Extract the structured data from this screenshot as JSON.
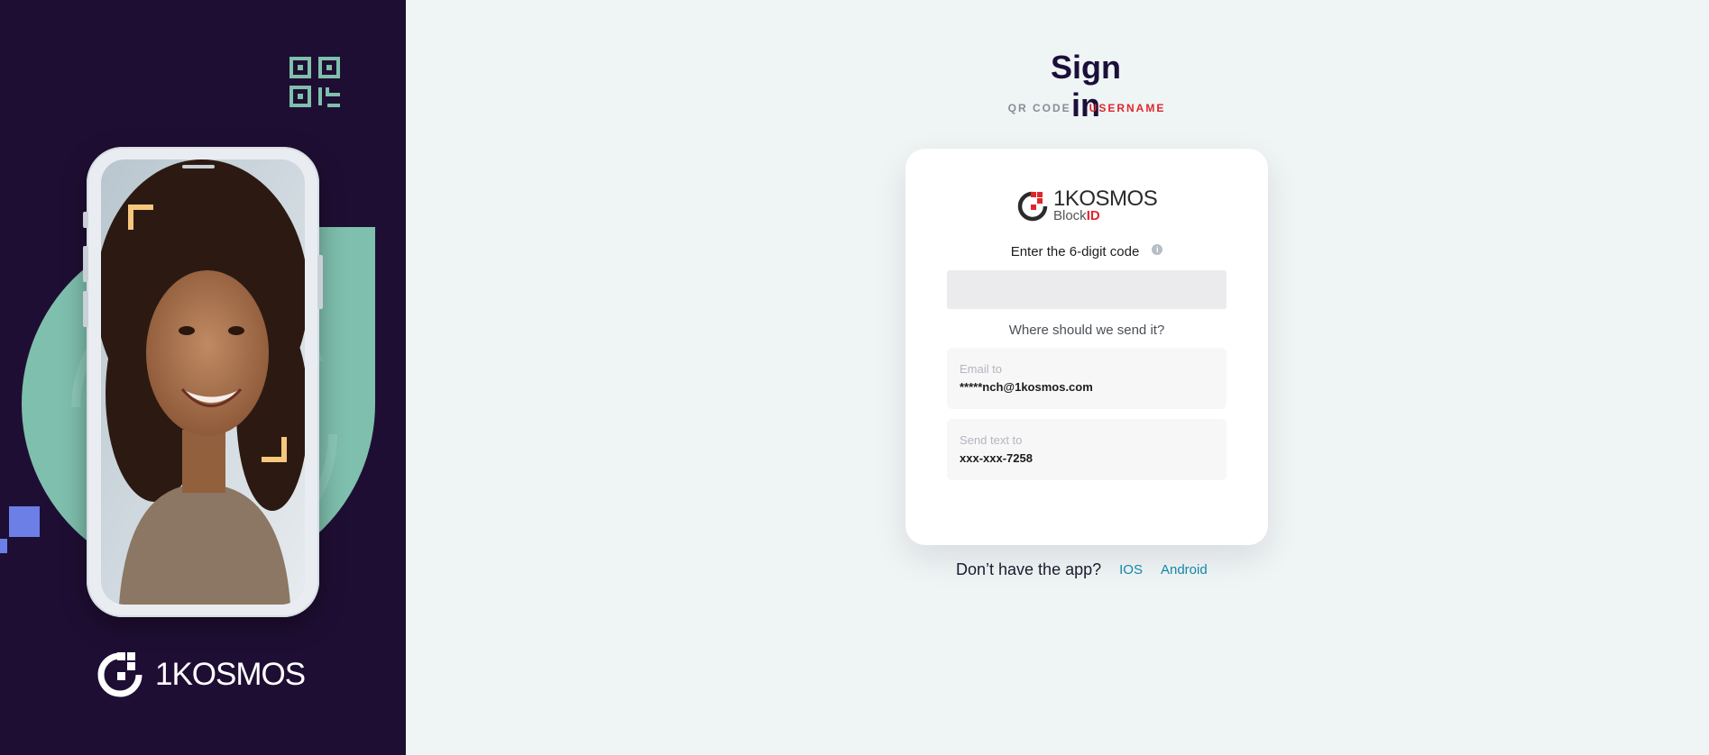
{
  "page": {
    "title": "Sign in"
  },
  "tabs": [
    {
      "label": "QR CODE",
      "active": false
    },
    {
      "label": "USERNAME",
      "active": true
    }
  ],
  "brand": {
    "name": "1KOSMOS"
  },
  "card": {
    "logo_line1": "1KOSMOS",
    "logo_line2_a": "Block",
    "logo_line2_b": "ID",
    "code_label": "Enter the 6-digit code",
    "info_icon": "info-icon",
    "code_value": "",
    "send_question": "Where should we send it?",
    "options": [
      {
        "label": "Email to",
        "value": "*****nch@1kosmos.com"
      },
      {
        "label": "Send text to",
        "value": "xxx-xxx-7258"
      }
    ]
  },
  "app": {
    "question": "Don’t have the app?",
    "ios_label": "IOS",
    "android_label": "Android"
  },
  "colors": {
    "left_bg": "#1f0e33",
    "teal": "#7fbfad",
    "accent_red": "#e0262c",
    "link": "#1487a8",
    "title": "#1b0f3a"
  }
}
